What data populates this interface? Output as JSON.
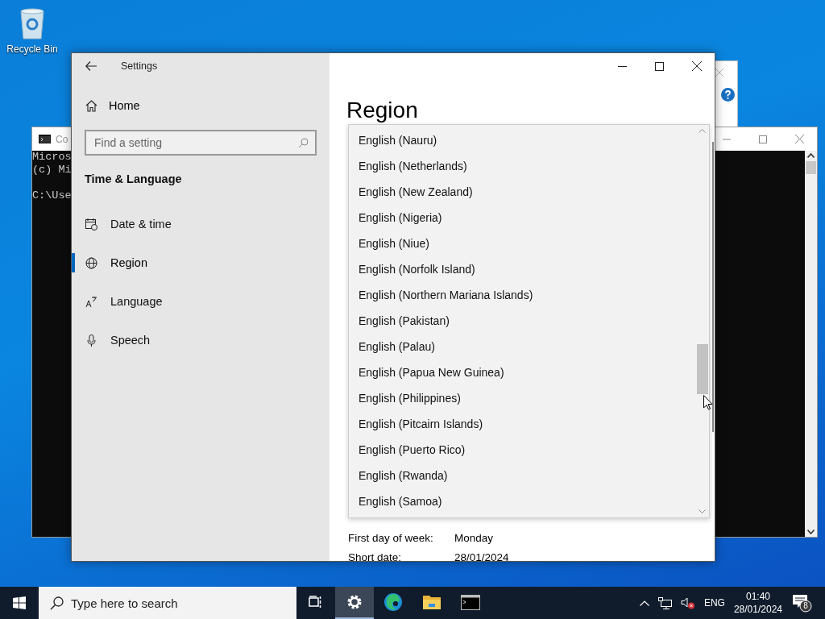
{
  "desktop": {
    "icons": [
      {
        "label": "Recycle Bin"
      }
    ]
  },
  "console_window": {
    "title": "Co",
    "lines": [
      "Micros",
      "(c) Mi",
      "C:\\Use"
    ]
  },
  "settings_window": {
    "title": "Settings",
    "nav": {
      "home": "Home",
      "search_placeholder": "Find a setting",
      "section": "Time & Language",
      "items": [
        {
          "label": "Date & time",
          "kind": "calendar",
          "selected": false
        },
        {
          "label": "Region",
          "kind": "globe",
          "selected": true
        },
        {
          "label": "Language",
          "kind": "language",
          "selected": false
        },
        {
          "label": "Speech",
          "kind": "microphone",
          "selected": false
        }
      ]
    },
    "page_title": "Region",
    "dropdown": {
      "options": [
        "English (Nauru)",
        "English (Netherlands)",
        "English (New Zealand)",
        "English (Nigeria)",
        "English (Niue)",
        "English (Norfolk Island)",
        "English (Northern Mariana Islands)",
        "English (Pakistan)",
        "English (Palau)",
        "English (Papua New Guinea)",
        "English (Philippines)",
        "English (Pitcairn Islands)",
        "English (Puerto Rico)",
        "English (Rwanda)",
        "English (Samoa)"
      ]
    },
    "fields": [
      {
        "label": "First day of week:",
        "value": "Monday"
      },
      {
        "label": "Short date:",
        "value": "28/01/2024"
      }
    ]
  },
  "taskbar": {
    "search_placeholder": "Type here to search",
    "apps": [
      {
        "kind": "task-view",
        "active": false
      },
      {
        "kind": "settings",
        "active": true
      },
      {
        "kind": "edge",
        "active": false
      },
      {
        "kind": "explorer",
        "active": false
      },
      {
        "kind": "terminal",
        "active": false
      }
    ],
    "tray": {
      "volume_muted": true,
      "language": "ENG",
      "time": "01:40",
      "date": "28/01/2024",
      "notifications": "8"
    }
  }
}
